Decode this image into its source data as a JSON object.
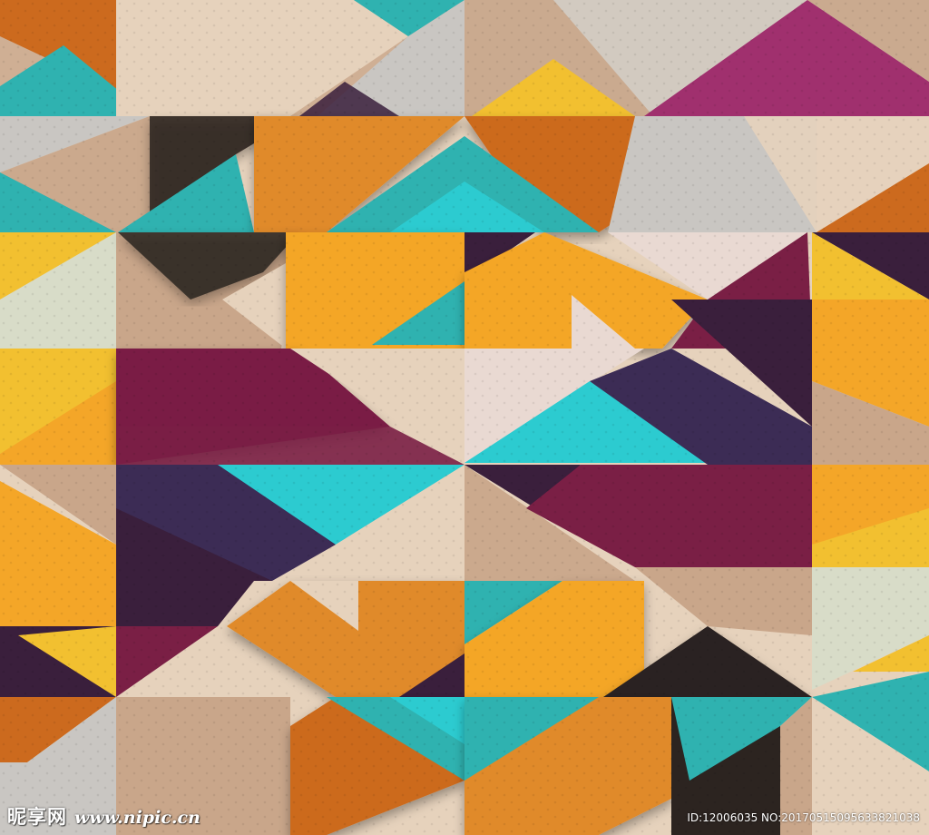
{
  "palette": {
    "teal": "#2fb2b0",
    "turquoise": "#2ccbd0",
    "orange": "#e08a2c",
    "burnt_orange": "#cc6a1e",
    "amber": "#f4a628",
    "yellow": "#f2c030",
    "magenta": "#a0306e",
    "wine": "#7a1f45",
    "plum": "#3a1f3c",
    "indigo": "#3c2c55",
    "beige": "#e6d2bc",
    "tan": "#c9a68a",
    "blush": "#e9d9d2",
    "gray": "#c9c6c2",
    "espresso": "#2c2420",
    "sage": "#d8dcc8"
  },
  "watermark": {
    "brand": "昵享网",
    "site": "www.nipic.cn",
    "id_text": "ID:12006035 NO:20170515095633821038"
  }
}
